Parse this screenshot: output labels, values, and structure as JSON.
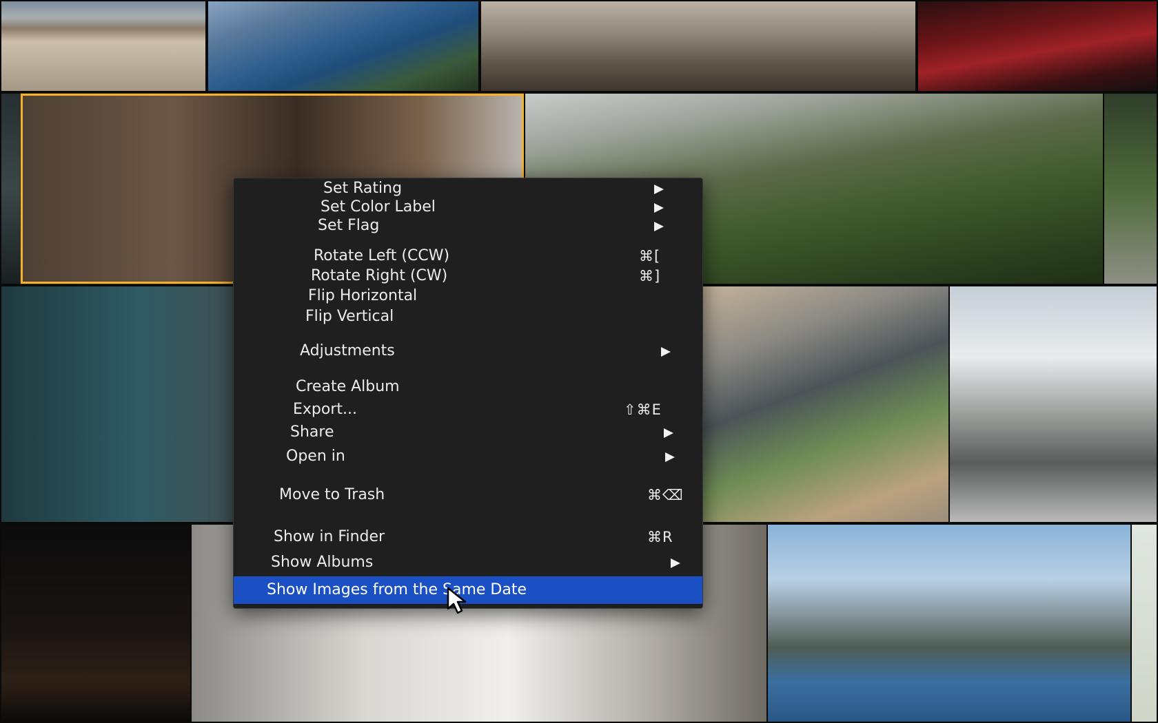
{
  "photos": [
    {
      "id": "temple",
      "desc": "temple-courtyard-photo"
    },
    {
      "id": "lake",
      "desc": "lake-view-photo"
    },
    {
      "id": "train",
      "desc": "train-interior-photo"
    },
    {
      "id": "car",
      "desc": "red-car-photo"
    },
    {
      "id": "dog",
      "desc": "dog-in-basket-photo"
    },
    {
      "id": "mountain",
      "desc": "mountain-valley-photo"
    },
    {
      "id": "plane",
      "desc": "airplane-cabin-photo"
    },
    {
      "id": "highway",
      "desc": "highway-interchange-photo"
    },
    {
      "id": "arch",
      "desc": "architecture-photo"
    },
    {
      "id": "night",
      "desc": "night-car-photo"
    },
    {
      "id": "passenger",
      "desc": "train-passenger-photo"
    },
    {
      "id": "fjord",
      "desc": "fjord-photo"
    }
  ],
  "context_menu": {
    "items": [
      {
        "label": "Set Rating",
        "submenu": true
      },
      {
        "label": "Set Color Label",
        "submenu": true
      },
      {
        "label": "Set Flag",
        "submenu": true
      },
      {
        "label": "Rotate Left (CCW)",
        "shortcut": "⌘["
      },
      {
        "label": "Rotate Right (CW)",
        "shortcut": "⌘]"
      },
      {
        "label": "Flip Horizontal"
      },
      {
        "label": "Flip Vertical"
      },
      {
        "label": "Adjustments",
        "submenu": true
      },
      {
        "label": "Create Album"
      },
      {
        "label": "Export...",
        "shortcut": "⇧⌘E"
      },
      {
        "label": "Share",
        "submenu": true
      },
      {
        "label": "Open in",
        "submenu": true
      },
      {
        "label": "Move to Trash",
        "shortcut": "⌘⌫"
      },
      {
        "label": "Show in Finder",
        "shortcut": "⌘R"
      },
      {
        "label": "Show Albums",
        "submenu": true
      },
      {
        "label": "Show Images from the Same Date",
        "highlighted": true
      }
    ]
  },
  "colors": {
    "selection_border": "#f4b233",
    "menu_background": "#1f1f1f",
    "highlight": "#1b4fc4",
    "menu_text": "#ececec"
  },
  "icons": {
    "submenu": "submenu-arrow-icon",
    "cursor": "mouse-pointer-icon"
  }
}
